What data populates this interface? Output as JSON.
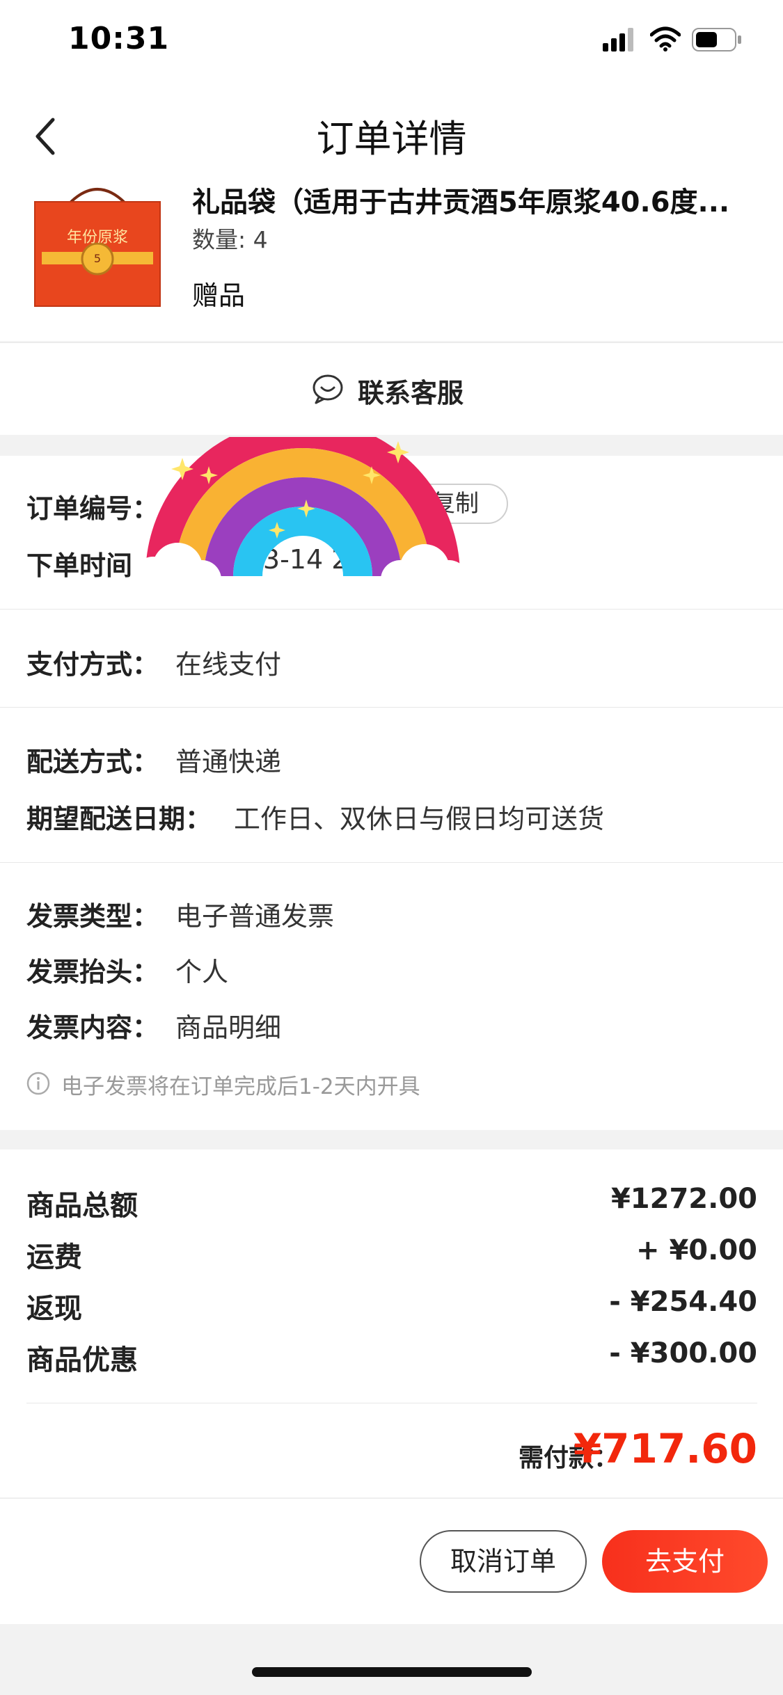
{
  "status": {
    "time": "10:31"
  },
  "nav": {
    "title": "订单详情"
  },
  "product": {
    "name": "礼品袋（适用于古井贡酒5年原浆40.6度...",
    "quantity": "数量: 4",
    "tag": "赠品",
    "image_caption": "年份原浆"
  },
  "contact": {
    "label": "联系客服"
  },
  "order": {
    "number_label": "订单编号：",
    "copy_label": "复制",
    "time_label": "下单时间",
    "time_value": "-03-14 2"
  },
  "payment": {
    "label": "支付方式：",
    "value": "在线支付"
  },
  "delivery": {
    "method_label": "配送方式：",
    "method_value": "普通快递",
    "date_label": "期望配送日期：",
    "date_value": "工作日、双休日与假日均可送货"
  },
  "invoice": {
    "type_label": "发票类型：",
    "type_value": "电子普通发票",
    "header_label": "发票抬头：",
    "header_value": "个人",
    "content_label": "发票内容：",
    "content_value": "商品明细",
    "note": "电子发票将在订单完成后1-2天内开具"
  },
  "amounts": {
    "rows": [
      {
        "label": "商品总额",
        "value": "¥1272.00"
      },
      {
        "label": "运费",
        "value": "+ ¥0.00"
      },
      {
        "label": "返现",
        "value": "- ¥254.40"
      },
      {
        "label": "商品优惠",
        "value": "- ¥300.00"
      }
    ],
    "need_label": "需付款：",
    "need_value": "¥717.60"
  },
  "footer": {
    "cancel_label": "取消订单",
    "pay_label": "去支付"
  },
  "colors": {
    "accent": "#f2270c",
    "rainbow": [
      "#e8265e",
      "#f9b233",
      "#9b3fbf",
      "#29c4f2"
    ]
  }
}
